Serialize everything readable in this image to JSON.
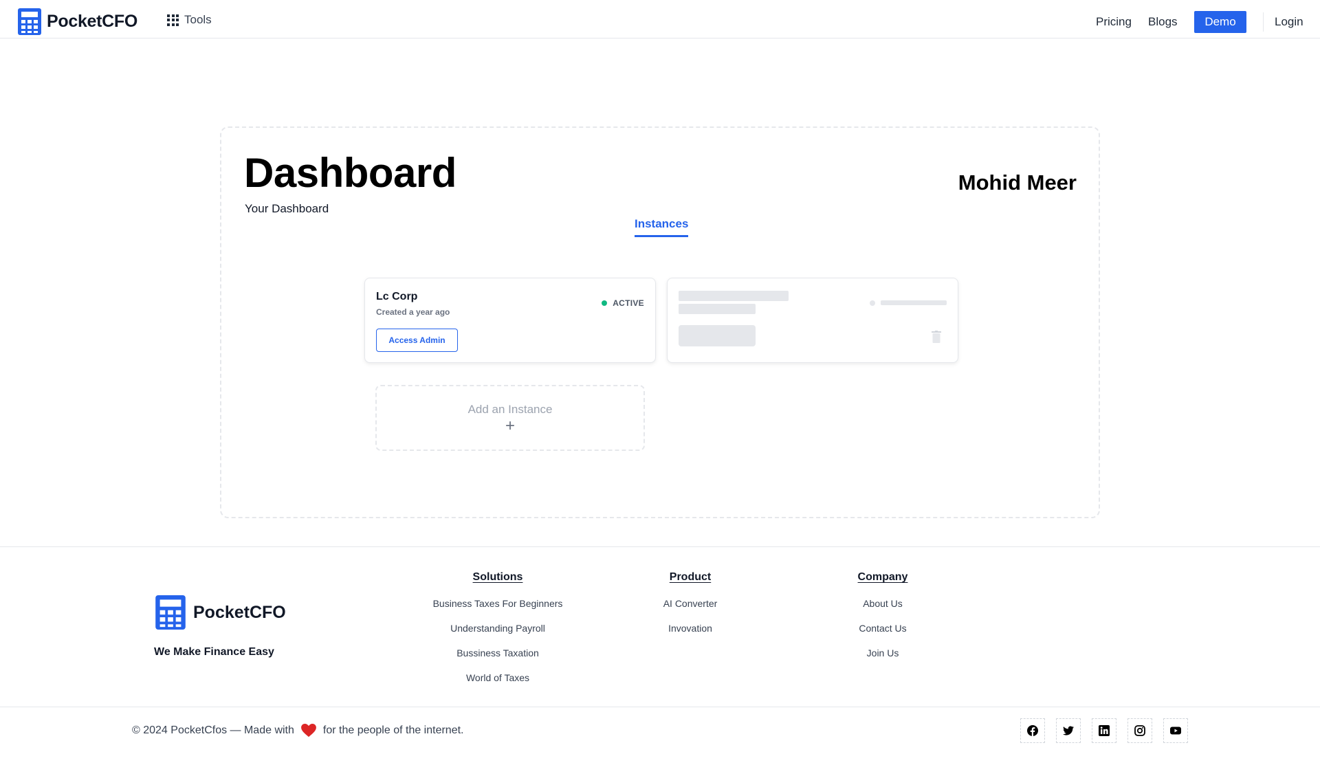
{
  "header": {
    "brand": "PocketCFO",
    "tools_label": "Tools",
    "nav": {
      "pricing": "Pricing",
      "blogs": "Blogs",
      "demo": "Demo",
      "login": "Login"
    }
  },
  "dashboard": {
    "title": "Dashboard",
    "subtitle": "Your Dashboard",
    "user_name": "Mohid Meer",
    "tabs": [
      {
        "label": "Instances",
        "active": true
      }
    ],
    "instances": [
      {
        "name": "Lc Corp",
        "created": "Created a year ago",
        "status": "ACTIVE",
        "status_color": "#10b981",
        "action_label": "Access Admin"
      }
    ],
    "loading_placeholder": true,
    "add_instance_label": "Add an Instance",
    "add_instance_icon": "+"
  },
  "footer": {
    "brand": "PocketCFO",
    "tagline": "We Make Finance Easy",
    "columns": [
      {
        "heading": "Solutions",
        "items": [
          "Business Taxes For Beginners",
          "Understanding Payroll",
          "Bussiness Taxation",
          "World of Taxes"
        ]
      },
      {
        "heading": "Product",
        "items": [
          "AI Converter",
          "Invovation"
        ]
      },
      {
        "heading": "Company",
        "items": [
          "About Us",
          "Contact Us",
          "Join Us"
        ]
      }
    ],
    "copyright_prefix": "© 2024 PocketCfos — Made with",
    "copyright_suffix": "for the people of the internet.",
    "social_icons": [
      "facebook-icon",
      "twitter-icon",
      "linkedin-icon",
      "instagram-icon",
      "youtube-icon"
    ]
  },
  "colors": {
    "accent": "#2563eb",
    "active": "#10b981",
    "heart": "#dc2626"
  }
}
